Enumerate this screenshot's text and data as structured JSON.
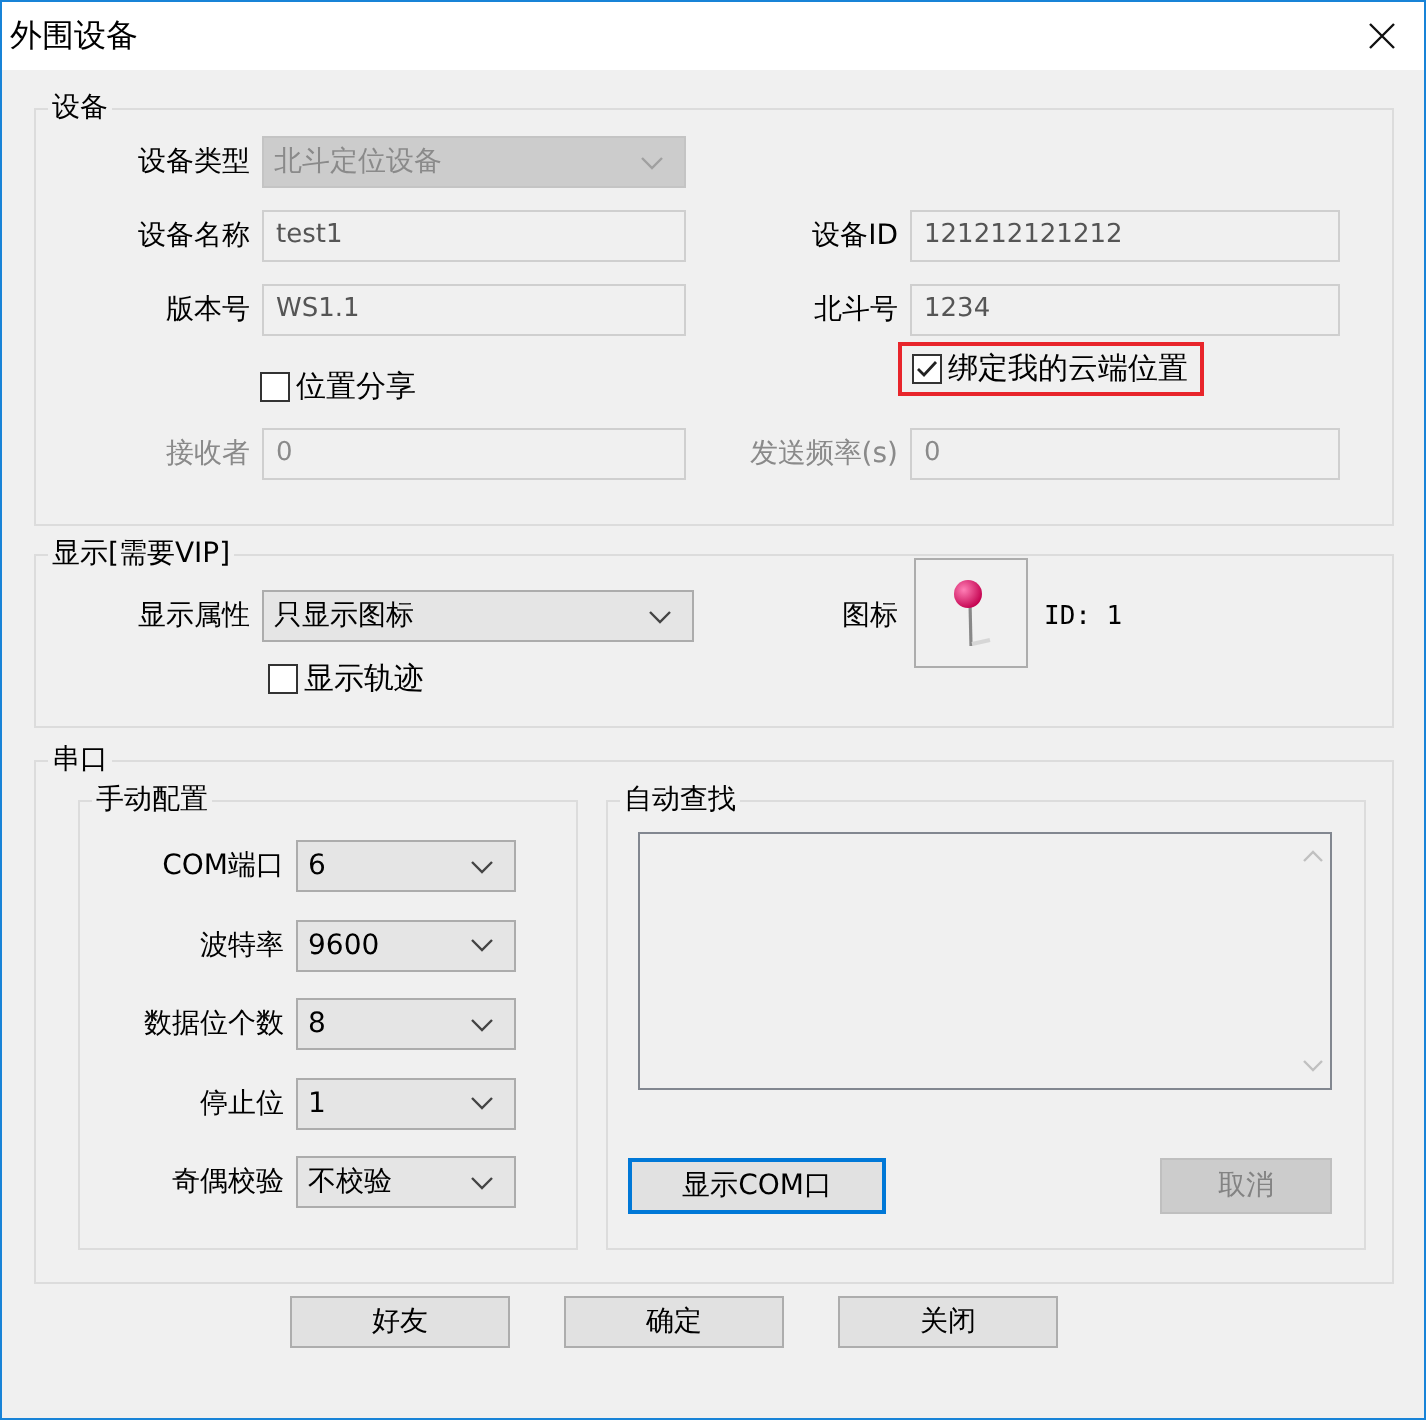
{
  "window": {
    "title": "外围设备"
  },
  "device": {
    "title": "设备",
    "type": {
      "label": "设备类型",
      "value": "北斗定位设备",
      "disabled": true
    },
    "name": {
      "label": "设备名称",
      "value": "test1",
      "disabled": false
    },
    "id": {
      "label": "设备ID",
      "value": "121212121212",
      "disabled": false
    },
    "version": {
      "label": "版本号",
      "value": "WS1.1",
      "disabled": false
    },
    "beidou": {
      "label": "北斗号",
      "value": "1234",
      "disabled": false
    },
    "share": {
      "label": "位置分享",
      "checked": false
    },
    "bind": {
      "label": "绑定我的云端位置",
      "checked": true,
      "highlighted": true
    },
    "receiver": {
      "label": "接收者",
      "value": "0",
      "disabled": true
    },
    "frequency": {
      "label": "发送频率(s)",
      "value": "0",
      "disabled": true
    }
  },
  "display": {
    "title": "显示[需要VIP]",
    "attribute": {
      "label": "显示属性",
      "value": "只显示图标"
    },
    "track": {
      "label": "显示轨迹",
      "checked": false
    },
    "icon": {
      "label": "图标",
      "id": "ID: 1"
    }
  },
  "serial": {
    "title": "串口",
    "manual": {
      "title": "手动配置",
      "rows": [
        {
          "label": "COM端口",
          "value": "6"
        },
        {
          "label": "波特率",
          "value": "9600"
        },
        {
          "label": "数据位个数",
          "value": "8"
        },
        {
          "label": "停止位",
          "value": "1"
        },
        {
          "label": "奇偶校验",
          "value": "不校验"
        }
      ]
    },
    "auto": {
      "title": "自动查找",
      "show_button": {
        "label": "显示COM口",
        "focused": true,
        "disabled": false
      },
      "cancel_button": {
        "label": "取消",
        "focused": false,
        "disabled": true
      }
    }
  },
  "buttons": [
    {
      "label": "好友"
    },
    {
      "label": "确定"
    },
    {
      "label": "关闭"
    }
  ]
}
